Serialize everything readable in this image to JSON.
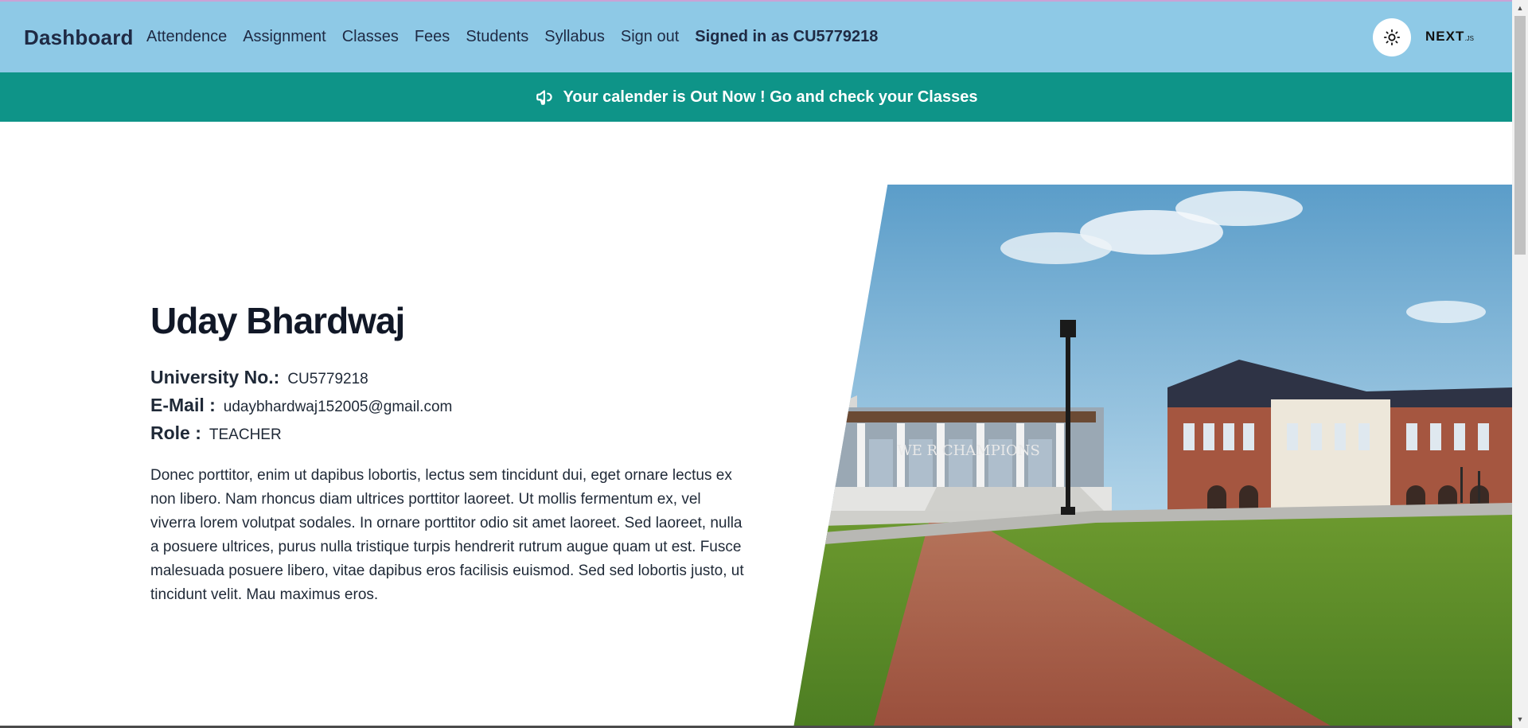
{
  "nav": {
    "brand": "Dashboard",
    "links": [
      "Attendence",
      "Assignment",
      "Classes",
      "Fees",
      "Students",
      "Syllabus",
      "Sign out"
    ],
    "signed_in": "Signed in as CU5779218",
    "theme_icon": "sun-icon",
    "logo_text": "NEXT",
    "logo_suffix": ".JS"
  },
  "banner": {
    "icon": "megaphone-icon",
    "text": "Your calender is Out Now ! Go and check your Classes"
  },
  "profile": {
    "name": "Uday Bhardwaj",
    "university_label": "University No.:",
    "university_value": "CU5779218",
    "email_label": "E-Mail :",
    "email_value": "udaybhardwaj152005@gmail.com",
    "role_label": "Role :",
    "role_value": "TEACHER",
    "bio": "Donec porttitor, enim ut dapibus lobortis, lectus sem tincidunt dui, eget ornare lectus ex non libero. Nam rhoncus diam ultrices porttitor laoreet. Ut mollis fermentum ex, vel viverra lorem volutpat sodales. In ornare porttitor odio sit amet laoreet. Sed laoreet, nulla a posuere ultrices, purus nulla tristique turpis hendrerit rutrum augue quam ut est. Fusce malesuada posuere libero, vitae dapibus eros facilisis euismod. Sed sed lobortis justo, ut tincidunt velit. Mau maximus eros."
  },
  "hero": {
    "building_sign": "WE R CHAMPIONS"
  },
  "colors": {
    "navbar": "#8ec9e6",
    "banner": "#0e9488",
    "text_dark": "#111827"
  }
}
